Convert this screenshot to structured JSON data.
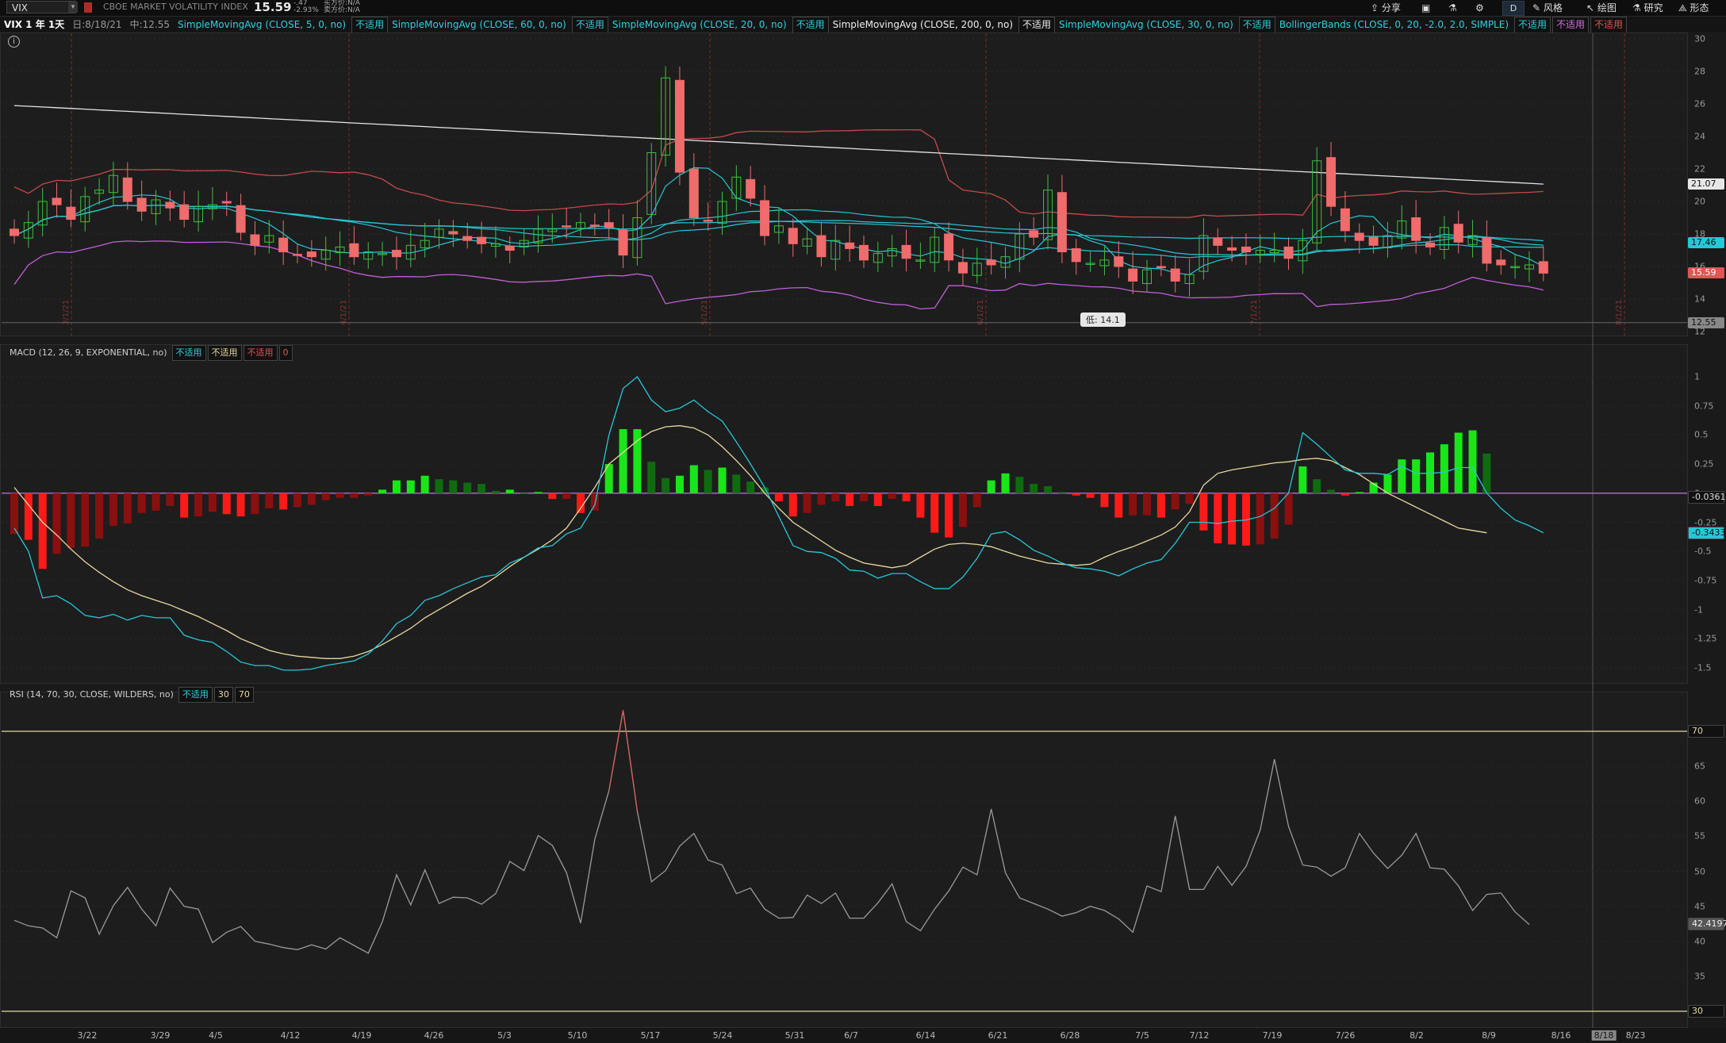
{
  "toolbar": {
    "symbol": "VIX",
    "description": "CBOE MARKET VOLATILITY INDEX",
    "last": "15.59",
    "change": "-.47",
    "change_pct": "-2.93%",
    "bid": "买方价:N/A",
    "ask": "卖方价:N/A",
    "share": "分享",
    "style": "风格",
    "draw": "绘图",
    "study": "研究",
    "pattern": "形态",
    "period_btn": "D"
  },
  "infobar": {
    "period": "VIX 1 年 1天",
    "date": "日:8/18/21",
    "high": "中:12.55",
    "studies": [
      {
        "label": "SimpleMovingAvg (CLOSE, 5, 0, no)",
        "status": "不适用"
      },
      {
        "label": "SimpleMovingAvg (CLOSE, 60, 0, no)",
        "status": "不适用"
      },
      {
        "label": "SimpleMovingAvg (CLOSE, 20, 0, no)",
        "status": "不适用"
      },
      {
        "label": "SimpleMovingAvg (CLOSE, 200, 0, no)",
        "status": "不适用"
      },
      {
        "label": "SimpleMovingAvg (CLOSE, 30, 0, no)",
        "status": "不适用"
      },
      {
        "label": "BollingerBands (CLOSE, 0, 20, -2.0, 2.0, SIMPLE)",
        "status": "不适用"
      }
    ],
    "bb_extra": [
      "不适用",
      "不适用"
    ]
  },
  "price_panel": {
    "y_ticks": [
      "30",
      "28",
      "26",
      "24",
      "22",
      "20",
      "18",
      "16",
      "14",
      "12"
    ],
    "tags": [
      {
        "value": "21.07",
        "bg": "#e6e6e6",
        "fg": "#111"
      },
      {
        "value": "17.46",
        "bg": "#26c7d6",
        "fg": "#111"
      },
      {
        "value": "15.59",
        "bg": "#e05555",
        "fg": "#fff"
      },
      {
        "value": "12.55",
        "bg": "#888",
        "fg": "#111"
      }
    ],
    "low_label": "低: 14.1",
    "month_markers": [
      "3/1/21",
      "4/1/21",
      "5/1/21",
      "6/1/21",
      "7/1/21",
      "8/1/21"
    ]
  },
  "macd_panel": {
    "label": "MACD (12, 26, 9, EXPONENTIAL, no)",
    "statuses": [
      "不适用",
      "不适用",
      "不适用",
      "0"
    ],
    "y_ticks": [
      "1",
      "0.75",
      "0.5",
      "0.25",
      "0",
      "-0.25",
      "-0.5",
      "-0.75",
      "-1",
      "-1.25",
      "-1.5"
    ],
    "tags": [
      {
        "value": "-0.0361",
        "bg": "#111",
        "fg": "#ddd"
      },
      {
        "value": "-0.3433",
        "bg": "#26c7d6",
        "fg": "#111"
      }
    ]
  },
  "rsi_panel": {
    "label": "RSI (14, 70, 30, CLOSE, WILDERS, no)",
    "statuses": [
      "不适用",
      "30",
      "70"
    ],
    "y_ticks": [
      "70",
      "65",
      "60",
      "55",
      "50",
      "45",
      "40",
      "35",
      "30"
    ],
    "tags": [
      {
        "value": "70",
        "bg": "#111",
        "fg": "#e8d9a0"
      },
      {
        "value": "42.4197",
        "bg": "#555",
        "fg": "#eee"
      },
      {
        "value": "30",
        "bg": "#111",
        "fg": "#e8d9a0"
      }
    ]
  },
  "x_axis": [
    "3/22",
    "3/29",
    "4/5",
    "4/12",
    "4/19",
    "4/26",
    "5/3",
    "5/10",
    "5/17",
    "5/24",
    "5/31",
    "6/7",
    "6/14",
    "6/21",
    "6/28",
    "7/5",
    "7/12",
    "7/19",
    "7/26",
    "8/2",
    "8/9",
    "8/16",
    "8/18",
    "8/23"
  ],
  "chart_data": {
    "type": "candlestick",
    "start": "3/16/21",
    "ylim": [
      12,
      30
    ],
    "closes": [
      17.9,
      18.7,
      20.0,
      19.8,
      18.9,
      20.3,
      20.7,
      21.6,
      20.0,
      19.4,
      20.1,
      19.6,
      18.9,
      19.7,
      19.8,
      19.9,
      18.1,
      17.3,
      17.9,
      16.9,
      16.7,
      16.6,
      17.0,
      17.2,
      16.6,
      16.9,
      16.8,
      16.6,
      17.3,
      17.6,
      18.3,
      18.0,
      17.6,
      17.4,
      17.4,
      17.0,
      17.6,
      18.3,
      18.3,
      18.5,
      18.7,
      18.5,
      18.4,
      16.7,
      19.0,
      23.0,
      27.6,
      21.8,
      19.0,
      18.8,
      20.0,
      21.5,
      20.2,
      17.9,
      18.5,
      17.4,
      17.7,
      16.6,
      17.6,
      17.1,
      16.4,
      16.8,
      17.1,
      16.5,
      16.4,
      17.8,
      16.4,
      15.6,
      16.2,
      16.1,
      16.6,
      18.0,
      17.8,
      20.7,
      16.9,
      16.3,
      16.2,
      16.4,
      16.0,
      15.1,
      15.8,
      16.0,
      15.1,
      15.5,
      17.9,
      17.3,
      17.0,
      16.9,
      17.0,
      17.0,
      16.5,
      17.6,
      22.5,
      19.7,
      18.2,
      17.6,
      17.3,
      17.9,
      18.8,
      17.6,
      17.2,
      18.4,
      17.5,
      17.9,
      16.2,
      16.1,
      16.0,
      16.1,
      15.59
    ],
    "macd": [
      -0.3,
      -0.5,
      -0.9,
      -0.88,
      -0.95,
      -1.05,
      -1.07,
      -1.04,
      -1.09,
      -1.05,
      -1.07,
      -1.07,
      -1.22,
      -1.26,
      -1.28,
      -1.36,
      -1.45,
      -1.48,
      -1.48,
      -1.52,
      -1.52,
      -1.51,
      -1.48,
      -1.46,
      -1.44,
      -1.38,
      -1.27,
      -1.12,
      -1.05,
      -0.92,
      -0.88,
      -0.82,
      -0.77,
      -0.72,
      -0.7,
      -0.6,
      -0.55,
      -0.47,
      -0.45,
      -0.35,
      -0.3,
      -0.1,
      0.5,
      0.9,
      1.0,
      0.8,
      0.7,
      0.73,
      0.8,
      0.7,
      0.62,
      0.44,
      0.25,
      0.05,
      -0.2,
      -0.45,
      -0.5,
      -0.51,
      -0.56,
      -0.66,
      -0.67,
      -0.73,
      -0.69,
      -0.69,
      -0.76,
      -0.82,
      -0.82,
      -0.72,
      -0.56,
      -0.35,
      -0.33,
      -0.4,
      -0.49,
      -0.54,
      -0.6,
      -0.64,
      -0.65,
      -0.67,
      -0.71,
      -0.65,
      -0.6,
      -0.57,
      -0.43,
      -0.25,
      -0.25,
      -0.26,
      -0.24,
      -0.23,
      -0.2,
      -0.13,
      0.0,
      0.52,
      0.42,
      0.31,
      0.2,
      0.17,
      0.17,
      0.16,
      0.23,
      0.17,
      0.17,
      0.18,
      0.22,
      0.22,
      0.0,
      -0.13,
      -0.23,
      -0.28,
      -0.34
    ],
    "signal": [
      0.05,
      -0.1,
      -0.25,
      -0.36,
      -0.48,
      -0.59,
      -0.68,
      -0.76,
      -0.83,
      -0.88,
      -0.92,
      -0.96,
      -1.01,
      -1.06,
      -1.12,
      -1.18,
      -1.25,
      -1.3,
      -1.35,
      -1.38,
      -1.4,
      -1.41,
      -1.42,
      -1.42,
      -1.4,
      -1.36,
      -1.3,
      -1.23,
      -1.16,
      -1.07,
      -1.0,
      -0.93,
      -0.86,
      -0.8,
      -0.72,
      -0.63,
      -0.55,
      -0.48,
      -0.4,
      -0.3,
      -0.13,
      0.05,
      0.25,
      0.35,
      0.45,
      0.53,
      0.57,
      0.58,
      0.56,
      0.5,
      0.4,
      0.28,
      0.15,
      0.0,
      -0.13,
      -0.25,
      -0.33,
      -0.41,
      -0.49,
      -0.55,
      -0.6,
      -0.62,
      -0.64,
      -0.62,
      -0.55,
      -0.48,
      -0.44,
      -0.43,
      -0.44,
      -0.46,
      -0.5,
      -0.54,
      -0.57,
      -0.6,
      -0.61,
      -0.62,
      -0.61,
      -0.55,
      -0.5,
      -0.46,
      -0.41,
      -0.36,
      -0.29,
      -0.16,
      0.07,
      0.17,
      0.2,
      0.22,
      0.24,
      0.26,
      0.27,
      0.29,
      0.3,
      0.28,
      0.22,
      0.16,
      0.08,
      0.0,
      -0.06,
      -0.12,
      -0.18,
      -0.24,
      -0.3,
      -0.32,
      -0.34
    ],
    "rsi": [
      43.0,
      42.2,
      41.9,
      40.5,
      47.2,
      46.2,
      41.0,
      45.1,
      47.7,
      44.6,
      42.2,
      47.6,
      45.0,
      44.6,
      39.8,
      41.3,
      42.1,
      40.0,
      39.6,
      39.1,
      38.8,
      39.5,
      38.9,
      40.5,
      39.4,
      38.3,
      42.8,
      49.5,
      45.2,
      50.2,
      45.4,
      46.3,
      46.2,
      45.3,
      46.8,
      51.4,
      50.1,
      55.1,
      53.7,
      49.8,
      42.6,
      54.6,
      61.5,
      73.0,
      58.6,
      48.5,
      50.1,
      53.6,
      55.4,
      51.6,
      50.9,
      46.8,
      47.6,
      44.6,
      43.3,
      43.4,
      46.6,
      45.4,
      46.9,
      43.3,
      43.3,
      45.5,
      48.2,
      42.8,
      41.5,
      44.6,
      47.2,
      50.6,
      49.5,
      58.9,
      49.8,
      46.2,
      45.4,
      44.6,
      43.6,
      44.1,
      45.0,
      44.4,
      43.2,
      41.3,
      47.9,
      47.1,
      57.9,
      47.4,
      47.4,
      50.7,
      48.0,
      50.7,
      55.9,
      66.0,
      56.4,
      50.9,
      50.6,
      49.3,
      50.5,
      55.4,
      52.6,
      50.4,
      52.3,
      55.4,
      50.5,
      50.3,
      47.9,
      44.4,
      46.7,
      46.9,
      44.2,
      42.4
    ]
  }
}
